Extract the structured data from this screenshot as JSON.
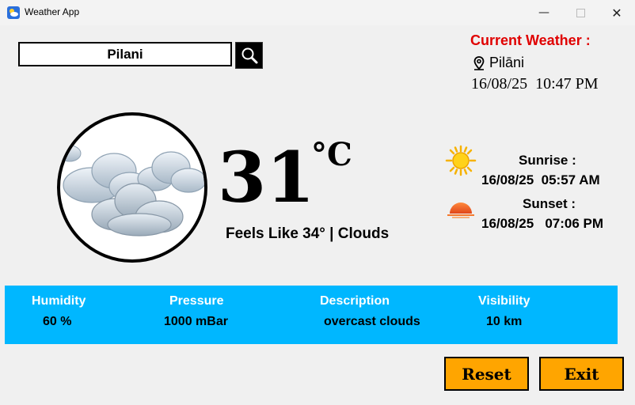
{
  "window": {
    "title": "Weather App",
    "min_glyph": "—",
    "close_glyph": "✕"
  },
  "search": {
    "value": "Pilani"
  },
  "current": {
    "heading": "Current Weather :",
    "location": "Pilāni",
    "datetime": "16/08/25  10:47 PM"
  },
  "weather": {
    "temperature": "31",
    "unit": "°C",
    "feels_like": "Feels Like 34° | Clouds",
    "icon": "clouds-icon"
  },
  "sun": {
    "sunrise_label": "Sunrise :",
    "sunrise_time": "16/08/25  05:57 AM",
    "sunset_label": "Sunset :",
    "sunset_time": "16/08/25   07:06 PM"
  },
  "info": [
    {
      "label": "Humidity",
      "value": "60 %"
    },
    {
      "label": "Pressure",
      "value": "1000 mBar"
    },
    {
      "label": "Description",
      "value": "overcast clouds"
    },
    {
      "label": "Visibility",
      "value": "10 km"
    }
  ],
  "buttons": {
    "reset": "Reset",
    "exit": "Exit"
  },
  "colors": {
    "accent_red": "#e00000",
    "info_bar": "#00b7ff",
    "button": "#ffa500"
  }
}
